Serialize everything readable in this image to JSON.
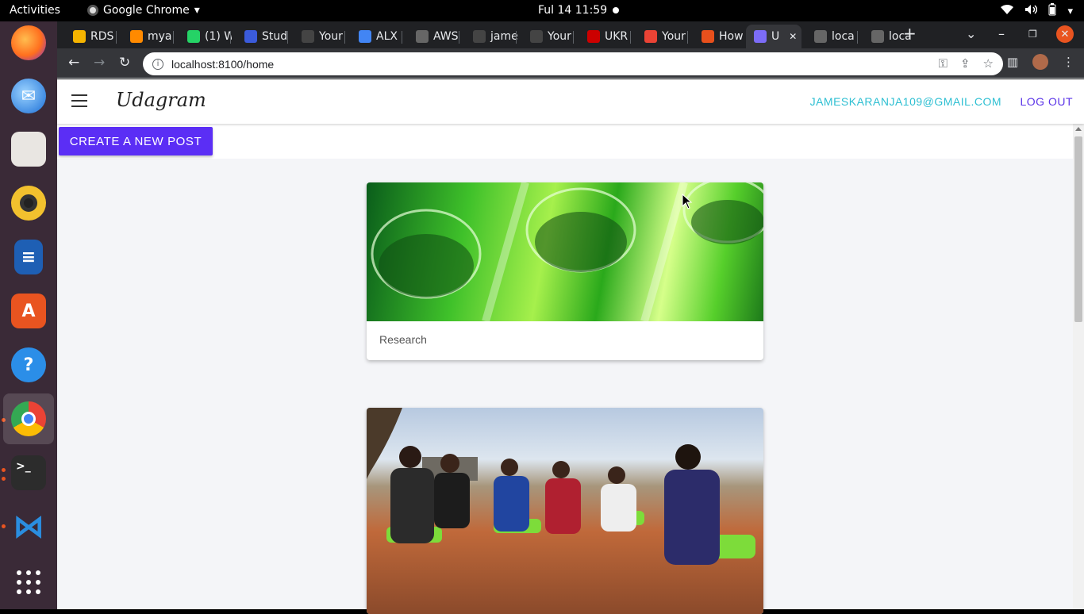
{
  "topbar": {
    "activities": "Activities",
    "app_name": "Google Chrome",
    "clock": "Ful 14  11:59"
  },
  "dock": {
    "items": [
      "firefox-icon",
      "thunderbird-icon",
      "files-icon",
      "rhythmbox-icon",
      "writer-icon",
      "app-center-icon",
      "help-icon",
      "chrome-icon",
      "terminal-icon",
      "vscode-icon",
      "show-apps-icon"
    ]
  },
  "tabs": [
    {
      "label": "RDS",
      "color": "#f5b400"
    },
    {
      "label": "mya",
      "color": "#ff8a00"
    },
    {
      "label": "(1) W",
      "color": "#25d366"
    },
    {
      "label": "Stud",
      "color": "#3b5bdb"
    },
    {
      "label": "Your",
      "color": "#444"
    },
    {
      "label": "ALX",
      "color": "#4285f4"
    },
    {
      "label": "AWS",
      "color": "#666"
    },
    {
      "label": "jame",
      "color": "#444"
    },
    {
      "label": "Your",
      "color": "#444"
    },
    {
      "label": "UKR",
      "color": "#c00"
    },
    {
      "label": "Your",
      "color": "#ea4335"
    },
    {
      "label": "How",
      "color": "#e8501c"
    },
    {
      "label": "U",
      "color": "#7c6cf7"
    },
    {
      "label": "loca",
      "color": "#666"
    },
    {
      "label": "loca",
      "color": "#666"
    }
  ],
  "address_bar": {
    "url": "localhost:8100/home"
  },
  "app": {
    "brand": "Udagram",
    "user_email": "JAMESKARANJA109@GMAIL.COM",
    "logout": "LOG OUT",
    "create_post": "CREATE A NEW POST",
    "accent": "#5b2ef5"
  },
  "feed": [
    {
      "caption": "Research",
      "image": "green test tubes"
    },
    {
      "caption": "",
      "image": "people seated in a circle outdoors"
    }
  ]
}
